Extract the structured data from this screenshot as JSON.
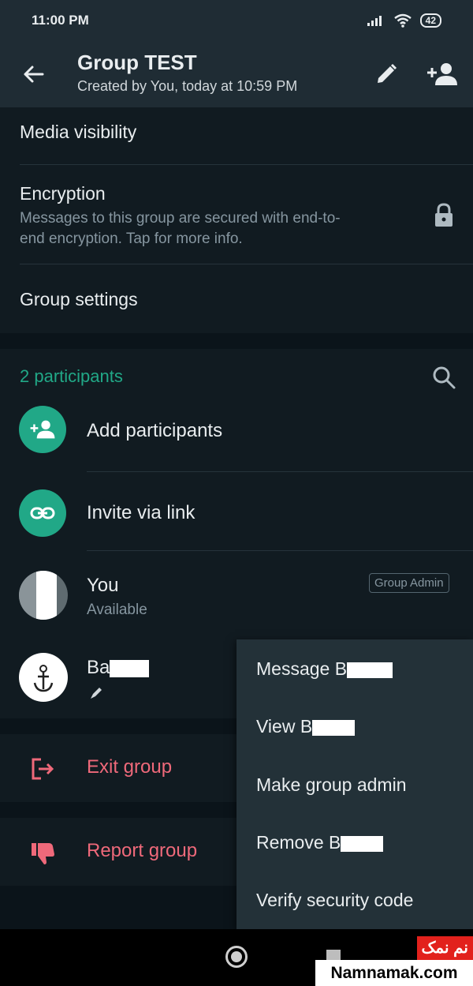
{
  "status_bar": {
    "time": "11:00 PM",
    "battery": "42"
  },
  "app_bar": {
    "title": "Group TEST",
    "subtitle": "Created by You, today at 10:59 PM"
  },
  "settings": {
    "media_visibility": "Media visibility",
    "encryption_title": "Encryption",
    "encryption_desc": "Messages to this group are secured with end-to-end encryption. Tap for more info.",
    "group_settings": "Group settings"
  },
  "participants": {
    "count_label": "2 participants",
    "add_label": "Add participants",
    "invite_label": "Invite via link",
    "members": [
      {
        "name": "You",
        "status": "Available",
        "badge": "Group Admin"
      },
      {
        "name_visible": "Ba"
      }
    ]
  },
  "actions": {
    "exit_label": "Exit group",
    "report_label": "Report group"
  },
  "context_menu": {
    "items": [
      {
        "prefix": "Message B"
      },
      {
        "prefix": "View B"
      },
      {
        "label": "Make group admin"
      },
      {
        "prefix": "Remove B"
      },
      {
        "label": "Verify security code"
      }
    ]
  },
  "watermark": {
    "top": "نم نمک",
    "bottom": "Namnamak.com"
  },
  "colors": {
    "accent": "#21a887",
    "danger": "#ef697a",
    "header": "#1f2c34",
    "surface": "#111b21",
    "menu": "#233138"
  }
}
